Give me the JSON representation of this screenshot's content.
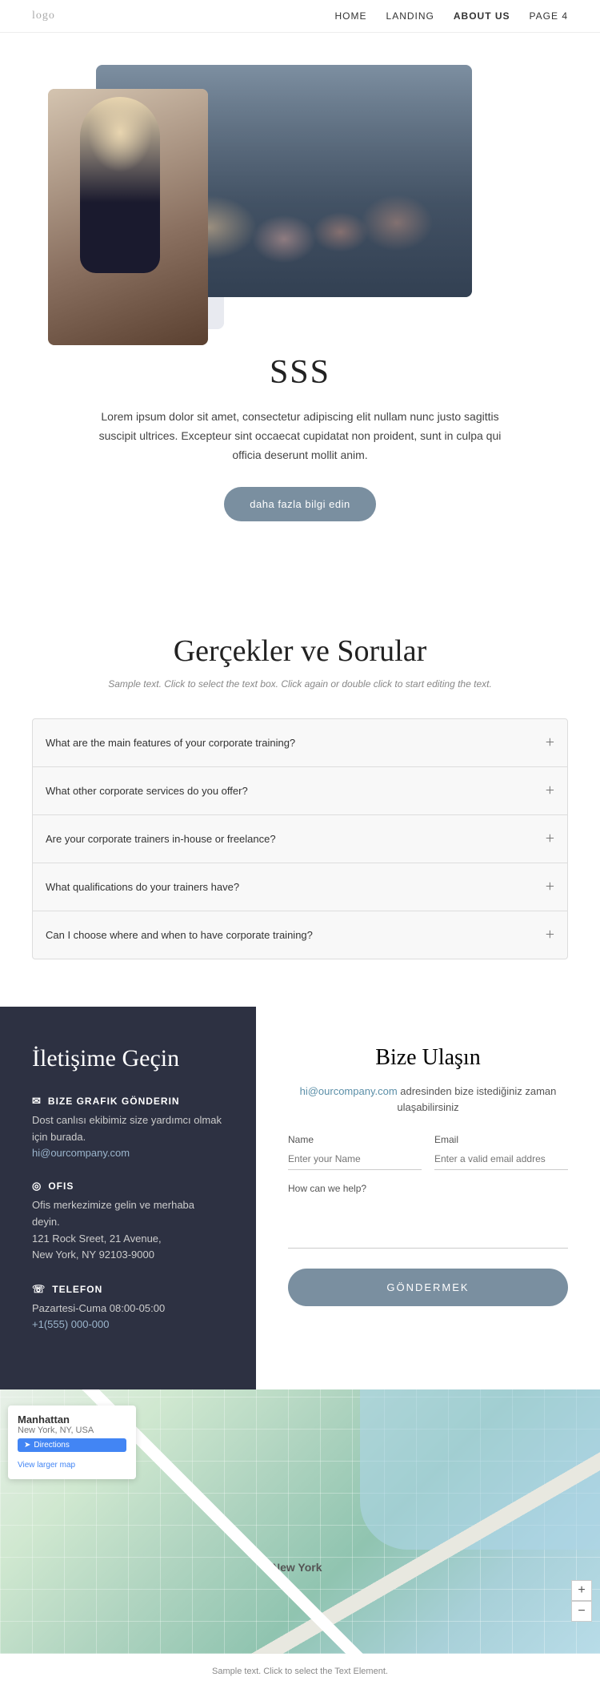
{
  "navbar": {
    "logo": "logo",
    "links": [
      {
        "label": "HOME",
        "href": "#",
        "active": false
      },
      {
        "label": "LANDING",
        "href": "#",
        "active": false
      },
      {
        "label": "ABOUT US",
        "href": "#",
        "active": true
      },
      {
        "label": "PAGE 4",
        "href": "#",
        "active": false
      }
    ]
  },
  "hero": {
    "title": "SSS",
    "description": "Lorem ipsum dolor sit amet, consectetur adipiscing elit nullam nunc justo sagittis suscipit ultrices. Excepteur sint occaecat cupidatat non proident, sunt in culpa qui officia deserunt mollit anim.",
    "button_label": "daha fazla bilgi edin"
  },
  "faq": {
    "title": "Gerçekler ve Sorular",
    "subtitle": "Sample text. Click to select the text box. Click again or double click to start editing the text.",
    "items": [
      {
        "question": "What are the main features of your corporate training?"
      },
      {
        "question": "What other corporate services do you offer?"
      },
      {
        "question": "Are your corporate trainers in-house or freelance?"
      },
      {
        "question": "What qualifications do your trainers have?"
      },
      {
        "question": "Can I choose where and when to have corporate training?"
      }
    ]
  },
  "contact": {
    "left": {
      "title": "İletişime Geçin",
      "email_section": {
        "icon": "✉",
        "title": "BIZE GRAFIK GÖNDERIN",
        "description": "Dost canlısı ekibimiz size yardımcı olmak için burada.",
        "link": "hi@ourcompany.com"
      },
      "office_section": {
        "icon": "◎",
        "title": "OFIS",
        "lines": [
          "Ofis merkezimize gelin ve merhaba deyin.",
          "121 Rock Sreet, 21 Avenue,",
          "New York, NY 92103-9000"
        ]
      },
      "phone_section": {
        "icon": "☏",
        "title": "TELEFON",
        "hours": "Pazartesi-Cuma 08:00-05:00",
        "phone": "+1(555) 000-000"
      }
    },
    "right": {
      "title": "Bize Ulaşın",
      "email_label": "hi@ourcompany.com",
      "email_desc": " adresinden bize istediğiniz zaman ulaşabilirsiniz",
      "name_label": "Name",
      "name_placeholder": "Enter your Name",
      "email_field_label": "Email",
      "email_placeholder": "Enter a valid email addres",
      "help_label": "How can we help?",
      "submit_label": "GÖNDERMEK"
    }
  },
  "map": {
    "city": "Manhattan",
    "state": "New York, NY, USA",
    "directions_label": "Directions",
    "view_larger_label": "View larger map",
    "label_ny": "New York"
  },
  "footer": {
    "text": "Sample text. Click to select the Text Element."
  }
}
